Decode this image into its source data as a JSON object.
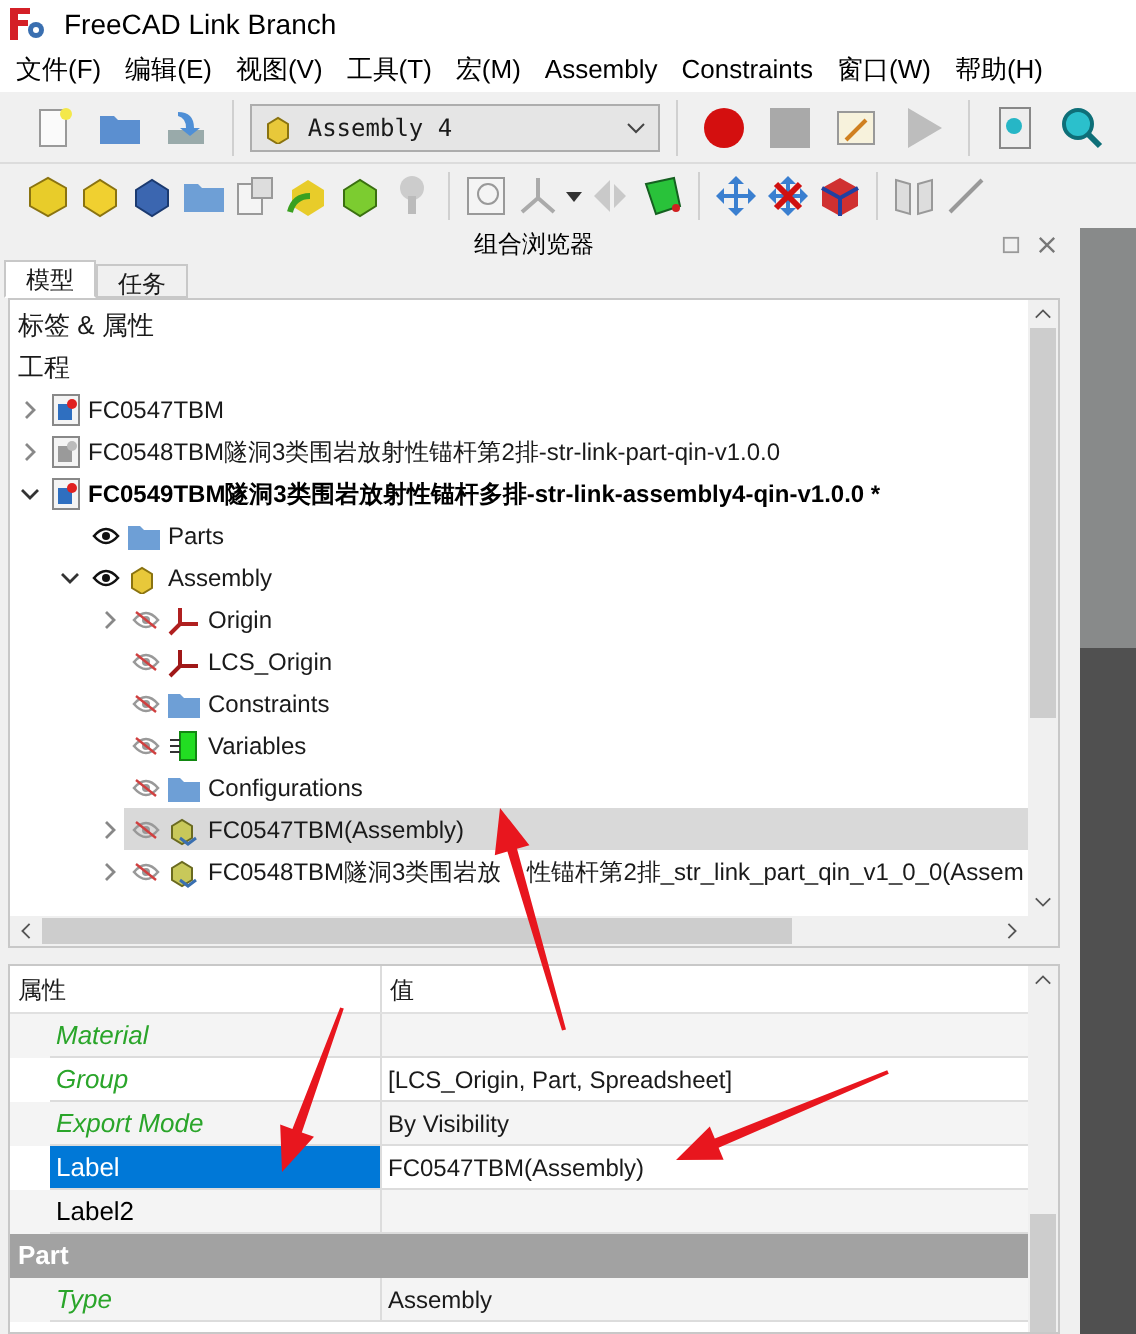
{
  "window": {
    "title": "FreeCAD Link Branch"
  },
  "menu": [
    "文件(F)",
    "编辑(E)",
    "视图(V)",
    "工具(T)",
    "宏(M)",
    "Assembly",
    "Constraints",
    "窗口(W)",
    "帮助(H)"
  ],
  "workbench_selector": {
    "value": "Assembly 4"
  },
  "dock": {
    "title": "组合浏览器"
  },
  "tabs": [
    {
      "label": "模型",
      "selected": true
    },
    {
      "label": "任务",
      "selected": false
    }
  ],
  "tree": {
    "header": "标签 & 属性",
    "root_label": "工程",
    "items": [
      {
        "label": "FC0547TBM",
        "kind": "document",
        "active": false,
        "expanded": false,
        "selected": false
      },
      {
        "label": "FC0548TBM隧洞3类围岩放射性锚杆第2排-str-link-part-qin-v1.0.0",
        "kind": "document-inactive",
        "active": false,
        "expanded": false,
        "selected": false
      },
      {
        "label": "FC0549TBM隧洞3类围岩放射性锚杆多排-str-link-assembly4-qin-v1.0.0 *",
        "kind": "document",
        "active": true,
        "expanded": true,
        "selected": false,
        "children": [
          {
            "label": "Parts",
            "kind": "folder",
            "visible": true,
            "selected": false
          },
          {
            "label": "Assembly",
            "kind": "assembly",
            "visible": true,
            "expanded": true,
            "selected": false,
            "children": [
              {
                "label": "Origin",
                "kind": "axes",
                "visible": false,
                "expanded": false,
                "selected": false
              },
              {
                "label": "LCS_Origin",
                "kind": "lcs",
                "visible": false,
                "selected": false
              },
              {
                "label": "Constraints",
                "kind": "folder",
                "visible": false,
                "selected": false
              },
              {
                "label": "Variables",
                "kind": "variables",
                "visible": false,
                "selected": false
              },
              {
                "label": "Configurations",
                "kind": "folder",
                "visible": false,
                "selected": false
              },
              {
                "label": "FC0547TBM(Assembly)",
                "kind": "link",
                "visible": false,
                "expanded": false,
                "selected": true
              },
              {
                "label": "FC0548TBM隧洞3类围岩放",
                "label_after_arrow": "性锚杆第2排_str_link_part_qin_v1_0_0(Assem",
                "kind": "link",
                "visible": false,
                "expanded": false,
                "selected": false
              }
            ]
          }
        ]
      }
    ]
  },
  "properties": {
    "columns": [
      "属性",
      "值"
    ],
    "rows": [
      {
        "kind": "readonly",
        "name": "Material",
        "selected": false
      },
      {
        "kind": "readonly",
        "name": "Group",
        "value": "[LCS_Origin, Part, Spreadsheet]",
        "selected": false
      },
      {
        "kind": "readonly",
        "name": "Export Mode",
        "value": "By Visibility",
        "selected": false
      },
      {
        "kind": "editable",
        "name": "Label",
        "value": "FC0547TBM(Assembly)",
        "selected": true
      },
      {
        "kind": "editable",
        "name": "Label2",
        "selected": false
      },
      {
        "kind": "group",
        "name": "Part"
      },
      {
        "kind": "readonly",
        "name": "Type",
        "value": "Assembly",
        "selected": false
      }
    ]
  }
}
